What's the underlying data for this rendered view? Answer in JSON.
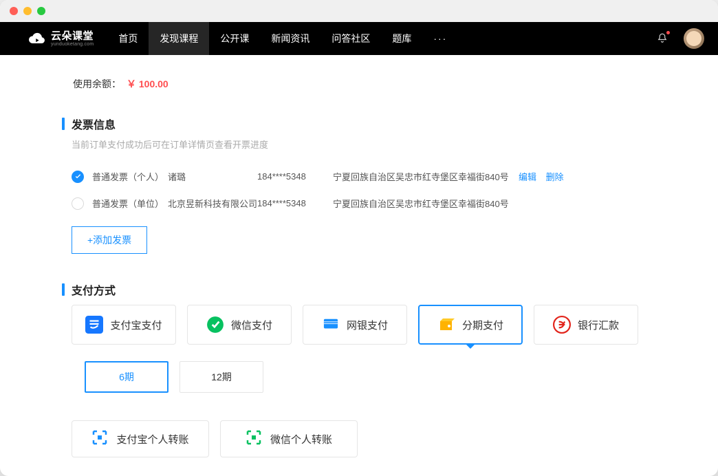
{
  "window": {
    "brand": "云朵课堂",
    "brand_sub": "yunduoketang.com"
  },
  "nav": {
    "items": [
      {
        "label": "首页",
        "active": false
      },
      {
        "label": "发现课程",
        "active": true
      },
      {
        "label": "公开课",
        "active": false
      },
      {
        "label": "新闻资讯",
        "active": false
      },
      {
        "label": "问答社区",
        "active": false
      },
      {
        "label": "题库",
        "active": false
      }
    ]
  },
  "balance": {
    "label": "使用余额：",
    "amount": "￥ 100.00"
  },
  "invoice": {
    "title": "发票信息",
    "subtitle": "当前订单支付成功后可在订单详情页查看开票进度",
    "rows": [
      {
        "type": "普通发票（个人）",
        "name": "诸璐",
        "phone": "184****5348",
        "addr": "宁夏回族自治区吴忠市红寺堡区幸福街840号",
        "selected": true,
        "actions": [
          "编辑",
          "删除"
        ]
      },
      {
        "type": "普通发票（单位）",
        "name": "北京昱新科技有限公司",
        "phone": "184****5348",
        "addr": "宁夏回族自治区吴忠市红寺堡区幸福街840号",
        "selected": false,
        "actions": []
      }
    ],
    "add_label": "+添加发票"
  },
  "payment": {
    "title": "支付方式",
    "options": [
      {
        "label": "支付宝支付",
        "icon": "alipay",
        "selected": false
      },
      {
        "label": "微信支付",
        "icon": "wechat",
        "selected": false
      },
      {
        "label": "网银支付",
        "icon": "unionpay",
        "selected": false
      },
      {
        "label": "分期支付",
        "icon": "installment",
        "selected": true
      },
      {
        "label": "银行汇款",
        "icon": "bankwire",
        "selected": false
      }
    ],
    "terms": [
      {
        "label": "6期",
        "selected": true
      },
      {
        "label": "12期",
        "selected": false
      }
    ],
    "transfers": [
      {
        "label": "支付宝个人转账",
        "icon": "scan-blue"
      },
      {
        "label": "微信个人转账",
        "icon": "scan-green"
      }
    ]
  }
}
